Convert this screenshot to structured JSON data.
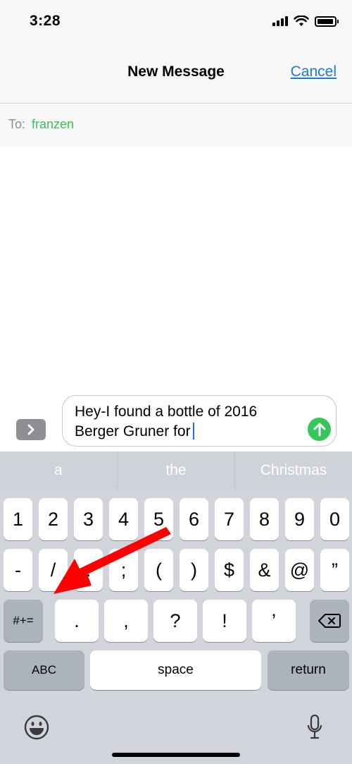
{
  "status_bar": {
    "time": "3:28"
  },
  "nav": {
    "title": "New Message",
    "cancel_label": "Cancel"
  },
  "recipient": {
    "label": "To:",
    "name": "franzen"
  },
  "compose": {
    "apps_icon": "chevron-right-icon",
    "text": "Hey-I found a bottle of 2016\nBerger Gruner for",
    "send_icon": "arrow-up-icon"
  },
  "predictions": [
    "a",
    "the",
    "Christmas"
  ],
  "keyboard": {
    "row1": [
      "1",
      "2",
      "3",
      "4",
      "5",
      "6",
      "7",
      "8",
      "9",
      "0"
    ],
    "row2": [
      "-",
      "/",
      ":",
      ";",
      "(",
      ")",
      "$",
      "&",
      "@",
      "”"
    ],
    "row3_left": "#+=",
    "row3": [
      ".",
      ",",
      "?",
      "!",
      "’"
    ],
    "abc_label": "ABC",
    "space_label": "space",
    "return_label": "return"
  },
  "annotation": {
    "color": "#ff0000",
    "icon": "red-arrow"
  }
}
